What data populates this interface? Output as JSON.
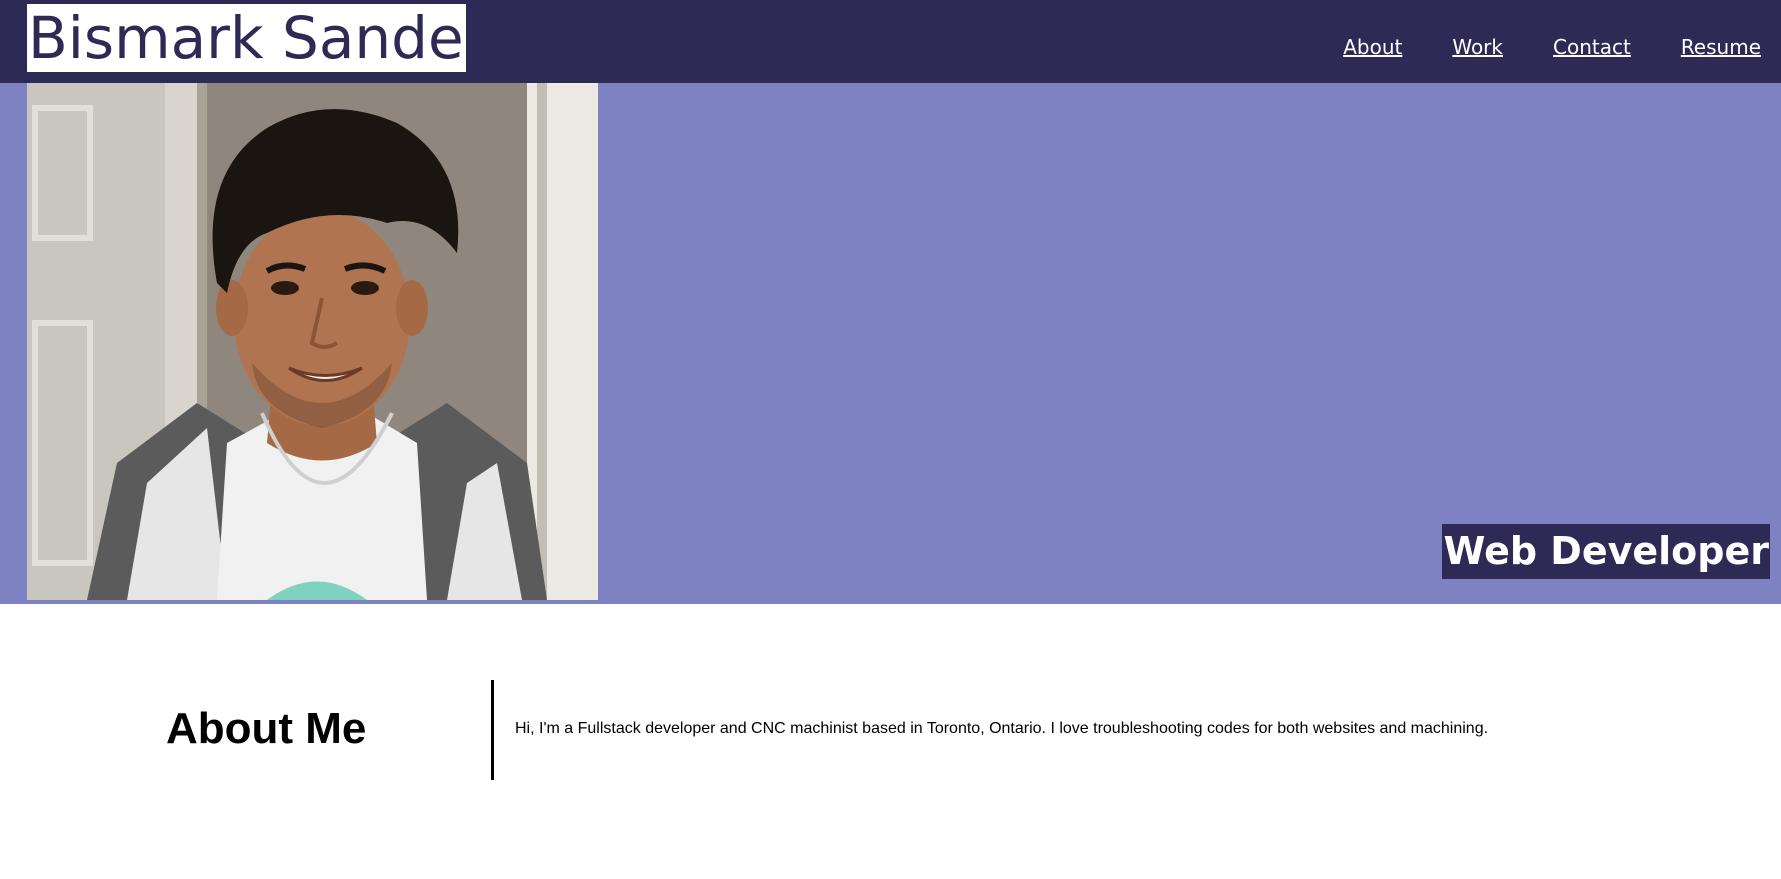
{
  "header": {
    "brand": "Bismark Sandez",
    "nav": [
      {
        "label": "About"
      },
      {
        "label": "Work"
      },
      {
        "label": "Contact"
      },
      {
        "label": "Resume"
      }
    ]
  },
  "hero": {
    "photo_alt": "portrait-photo",
    "role": "Web Developer"
  },
  "about": {
    "title": "About Me",
    "text": "Hi, I'm a Fullstack developer and CNC machinist based in Toronto, Ontario. I love troubleshooting codes for both websites and machining."
  },
  "colors": {
    "header_bg": "#2d2a56",
    "hero_bg": "#7e82c2",
    "accent_text": "#ffffff"
  }
}
